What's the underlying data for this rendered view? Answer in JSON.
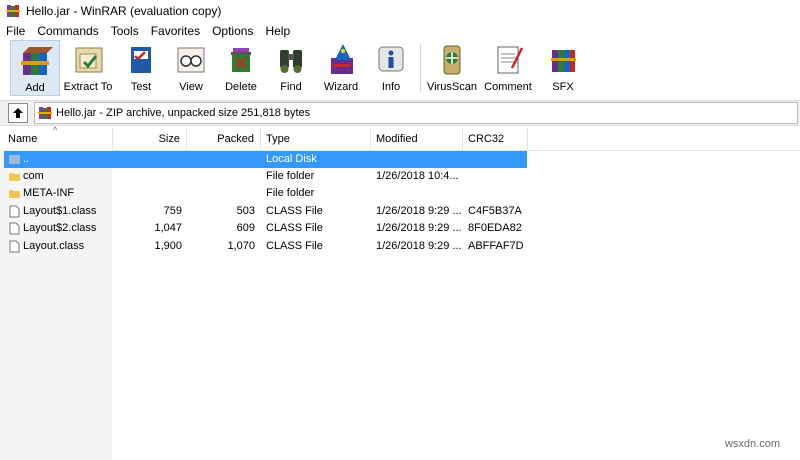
{
  "window": {
    "title": "Hello.jar - WinRAR (evaluation copy)"
  },
  "menu": [
    "File",
    "Commands",
    "Tools",
    "Favorites",
    "Options",
    "Help"
  ],
  "toolbar": [
    {
      "label": "Add",
      "icon": "add-books-icon"
    },
    {
      "label": "Extract To",
      "icon": "extract-folder-icon"
    },
    {
      "label": "Test",
      "icon": "test-book-icon"
    },
    {
      "label": "View",
      "icon": "view-glasses-icon"
    },
    {
      "label": "Delete",
      "icon": "delete-bin-icon"
    },
    {
      "label": "Find",
      "icon": "binoculars-icon"
    },
    {
      "label": "Wizard",
      "icon": "wizard-hat-icon"
    },
    {
      "label": "Info",
      "icon": "info-icon"
    },
    {
      "label": "VirusScan",
      "icon": "virusscan-icon"
    },
    {
      "label": "Comment",
      "icon": "comment-notepad-icon"
    },
    {
      "label": "SFX",
      "icon": "sfx-books-icon"
    }
  ],
  "address": {
    "text": "Hello.jar - ZIP archive, unpacked size 251,818 bytes"
  },
  "columns": {
    "name": "Name",
    "size": "Size",
    "packed": "Packed",
    "type": "Type",
    "modified": "Modified",
    "crc": "CRC32"
  },
  "files": [
    {
      "name": "..",
      "size": "",
      "packed": "",
      "type": "Local Disk",
      "modified": "",
      "crc": "",
      "kind": "updir"
    },
    {
      "name": "com",
      "size": "",
      "packed": "",
      "type": "File folder",
      "modified": "1/26/2018 10:4...",
      "crc": "",
      "kind": "folder"
    },
    {
      "name": "META-INF",
      "size": "",
      "packed": "",
      "type": "File folder",
      "modified": "",
      "crc": "",
      "kind": "folder"
    },
    {
      "name": "Layout$1.class",
      "size": "759",
      "packed": "503",
      "type": "CLASS File",
      "modified": "1/26/2018 9:29 ...",
      "crc": "C4F5B37A",
      "kind": "file"
    },
    {
      "name": "Layout$2.class",
      "size": "1,047",
      "packed": "609",
      "type": "CLASS File",
      "modified": "1/26/2018 9:29 ...",
      "crc": "8F0EDA82",
      "kind": "file"
    },
    {
      "name": "Layout.class",
      "size": "1,900",
      "packed": "1,070",
      "type": "CLASS File",
      "modified": "1/26/2018 9:29 ...",
      "crc": "ABFFAF7D",
      "kind": "file"
    }
  ],
  "watermark": "wsxdn.com",
  "colors": {
    "selection": "#3399ff",
    "folder": "#f3c654",
    "toolbar_active": "#dde8f5"
  }
}
